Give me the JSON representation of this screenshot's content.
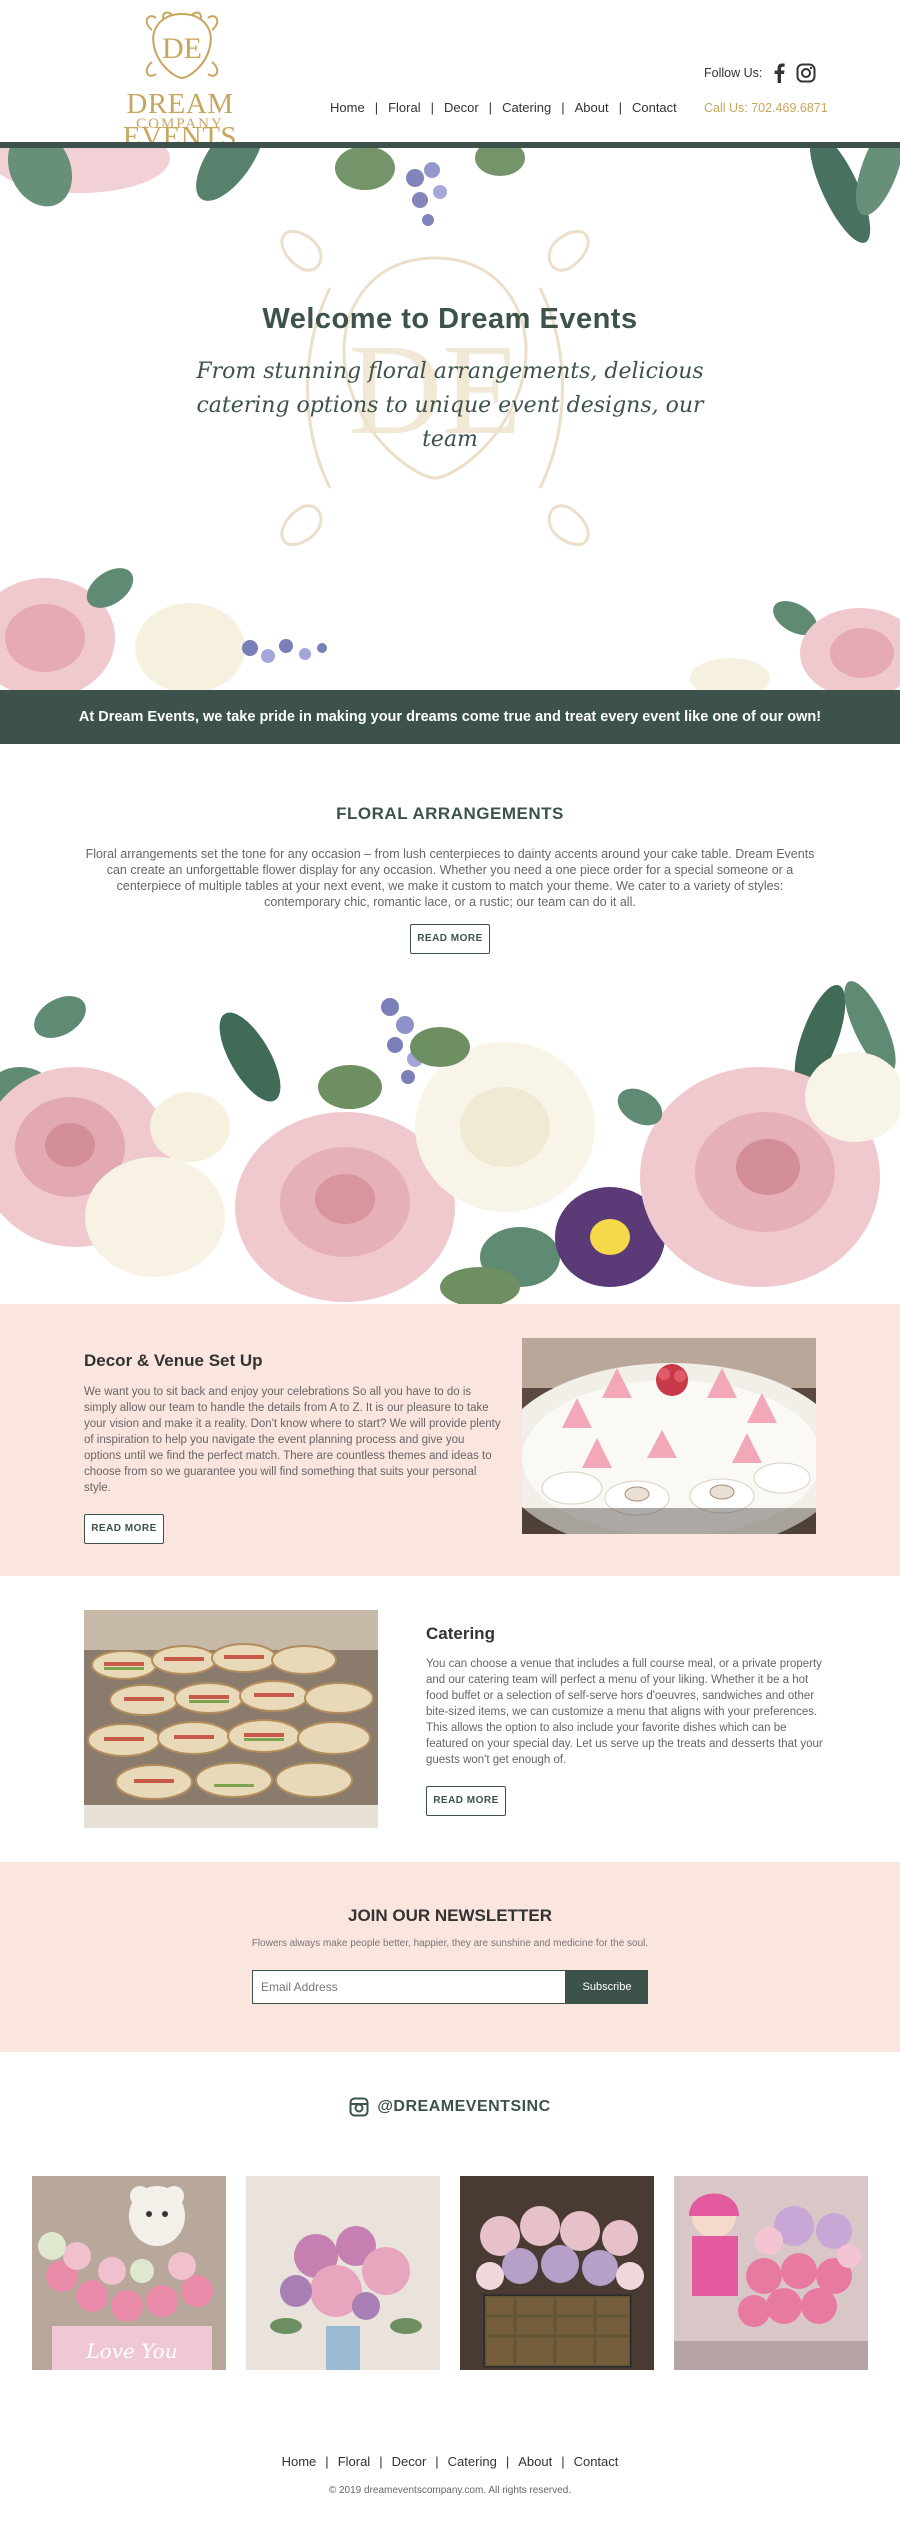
{
  "brand": {
    "name": "DREAM EVENTS",
    "tagline": "COMPANY",
    "monogram": "DE",
    "gold": "#c9a65d",
    "green": "#3d524a",
    "blush": "#fbe5df"
  },
  "nav": {
    "items": [
      "Home",
      "Floral",
      "Decor",
      "Catering",
      "About",
      "Contact"
    ],
    "separator": "|"
  },
  "header": {
    "follow_label": "Follow Us:",
    "social_icons": [
      "facebook-icon",
      "instagram-icon"
    ],
    "call_label": "Call Us: 702.469.6871"
  },
  "hero": {
    "title": "Welcome to Dream Events",
    "subtitle": "From stunning floral arrangements, delicious catering options to unique event designs, our team",
    "band_text": "At Dream Events, we take pride in making your dreams come true and treat every event like one of our own!"
  },
  "floral": {
    "heading": "FLORAL ARRANGEMENTS",
    "text": "Floral arrangements set the tone for any occasion – from lush centerpieces to dainty accents around your cake table. Dream Events can create an unforgettable flower display for any occasion. Whether you need a one piece order for a special someone or a centerpiece of multiple tables at your next event, we make it custom to match your theme. We cater to a variety of styles: contemporary chic, romantic lace, or a rustic; our team can do it all.",
    "button": "READ MORE"
  },
  "decor": {
    "heading": "Decor & Venue Set Up",
    "text": "We want you to sit back and enjoy your celebrations So all you have to do is simply allow our team to handle the details from A to Z. It is our pleasure to take your vision and make it a reality. Don't know where to start? We will provide plenty of inspiration to help you navigate the event planning process and give you options until we find the perfect match. There are countless themes and ideas to choose from so we guarantee you will find something that suits your personal style.",
    "button": "READ MORE"
  },
  "catering": {
    "heading": "Catering",
    "text": "You can choose a venue that includes a full course meal, or a private property and our catering team will perfect a menu of your liking. Whether it be a hot food buffet or a selection of self-serve hors d'oeuvres, sandwiches and other bite-sized items, we can customize a menu that aligns with your preferences. This allows the option to also include your favorite dishes which can be featured on your special day. Let us serve up the treats and desserts that your guests won't get enough of.",
    "button": "READ MORE"
  },
  "newsletter": {
    "heading": "JOIN OUR NEWSLETTER",
    "subtitle": "Flowers always make people better, happier, they are sunshine and medicine for the soul.",
    "placeholder": "Email Address",
    "button": "Subscribe"
  },
  "instagram": {
    "handle": "@DREAMEVENTSINC",
    "photos": [
      "gallery-photo-teddy-bear-bouquet",
      "gallery-photo-peony-bouquet",
      "gallery-photo-rose-basket",
      "gallery-photo-doll-arrangement"
    ],
    "photo_text": "Love You"
  },
  "footer": {
    "copyright": "© 2019 dreameventscompany.com. All rights reserved."
  }
}
